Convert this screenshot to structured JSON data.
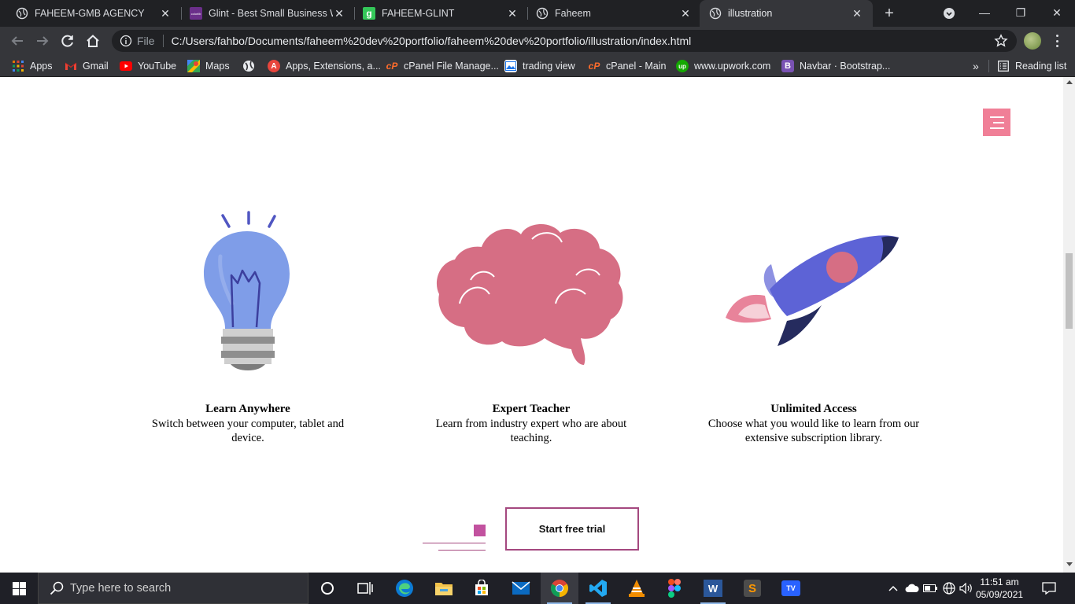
{
  "browser": {
    "tabs": [
      {
        "title": "FAHEEM-GMB AGENCY"
      },
      {
        "title": "Glint - Best Small Business W"
      },
      {
        "title": "FAHEEM-GLINT"
      },
      {
        "title": "Faheem"
      },
      {
        "title": "illustration"
      }
    ],
    "favicon_glint_text": "colorlib",
    "favicon_g_text": "g",
    "address_prefix": "File",
    "url": "C:/Users/fahbo/Documents/faheem%20dev%20portfolio/faheem%20dev%20portfolio/illustration/index.html",
    "bookmarks": [
      {
        "label": "Apps",
        "icon": "apps-grid-icon"
      },
      {
        "label": "Gmail",
        "icon": "gmail-icon"
      },
      {
        "label": "YouTube",
        "icon": "youtube-icon"
      },
      {
        "label": "Maps",
        "icon": "maps-icon"
      },
      {
        "label": "",
        "icon": "globe-icon"
      },
      {
        "label": "Apps, Extensions, a...",
        "icon": "extensions-icon"
      },
      {
        "label": "cPanel File Manage...",
        "icon": "cpanel-icon"
      },
      {
        "label": "trading view",
        "icon": "image-icon"
      },
      {
        "label": "cPanel - Main",
        "icon": "cpanel-icon"
      },
      {
        "label": "www.upwork.com",
        "icon": "upwork-icon"
      },
      {
        "label": "Navbar · Bootstrap...",
        "icon": "bootstrap-icon"
      }
    ],
    "bookmark_badges": {
      "extensions": "A",
      "cpanel": "cP",
      "upwork": "up",
      "bootstrap": "B"
    },
    "more_bookmarks": "»",
    "reading_list": "Reading list"
  },
  "page": {
    "features": [
      {
        "title": "Learn Anywhere",
        "text": "Switch between your computer, tablet and device."
      },
      {
        "title": "Expert Teacher",
        "text": "Learn from industry expert who are about teaching."
      },
      {
        "title": "Unlimited Access",
        "text": "Choose what you would like to learn from our extensive subscription library."
      }
    ],
    "cta_label": "Start free trial",
    "colors": {
      "accent_pink": "#f07f97",
      "brain": "#d66e84",
      "bulb": "#7f9de8",
      "rocket": "#5d63d6",
      "cta_border": "#a4487f"
    }
  },
  "taskbar": {
    "search_placeholder": "Type here to search",
    "time": "11:51 am",
    "date": "05/09/2021",
    "apps": [
      "cortana-icon",
      "task-view-icon",
      "edge-icon",
      "file-explorer-icon",
      "store-icon",
      "mail-icon",
      "chrome-icon",
      "vscode-icon",
      "vlc-icon",
      "figma-icon",
      "word-icon",
      "sublime-icon",
      "tradingview-icon"
    ],
    "app_badges": {
      "word": "W",
      "sublime": "S",
      "tradingview": "TV"
    }
  }
}
